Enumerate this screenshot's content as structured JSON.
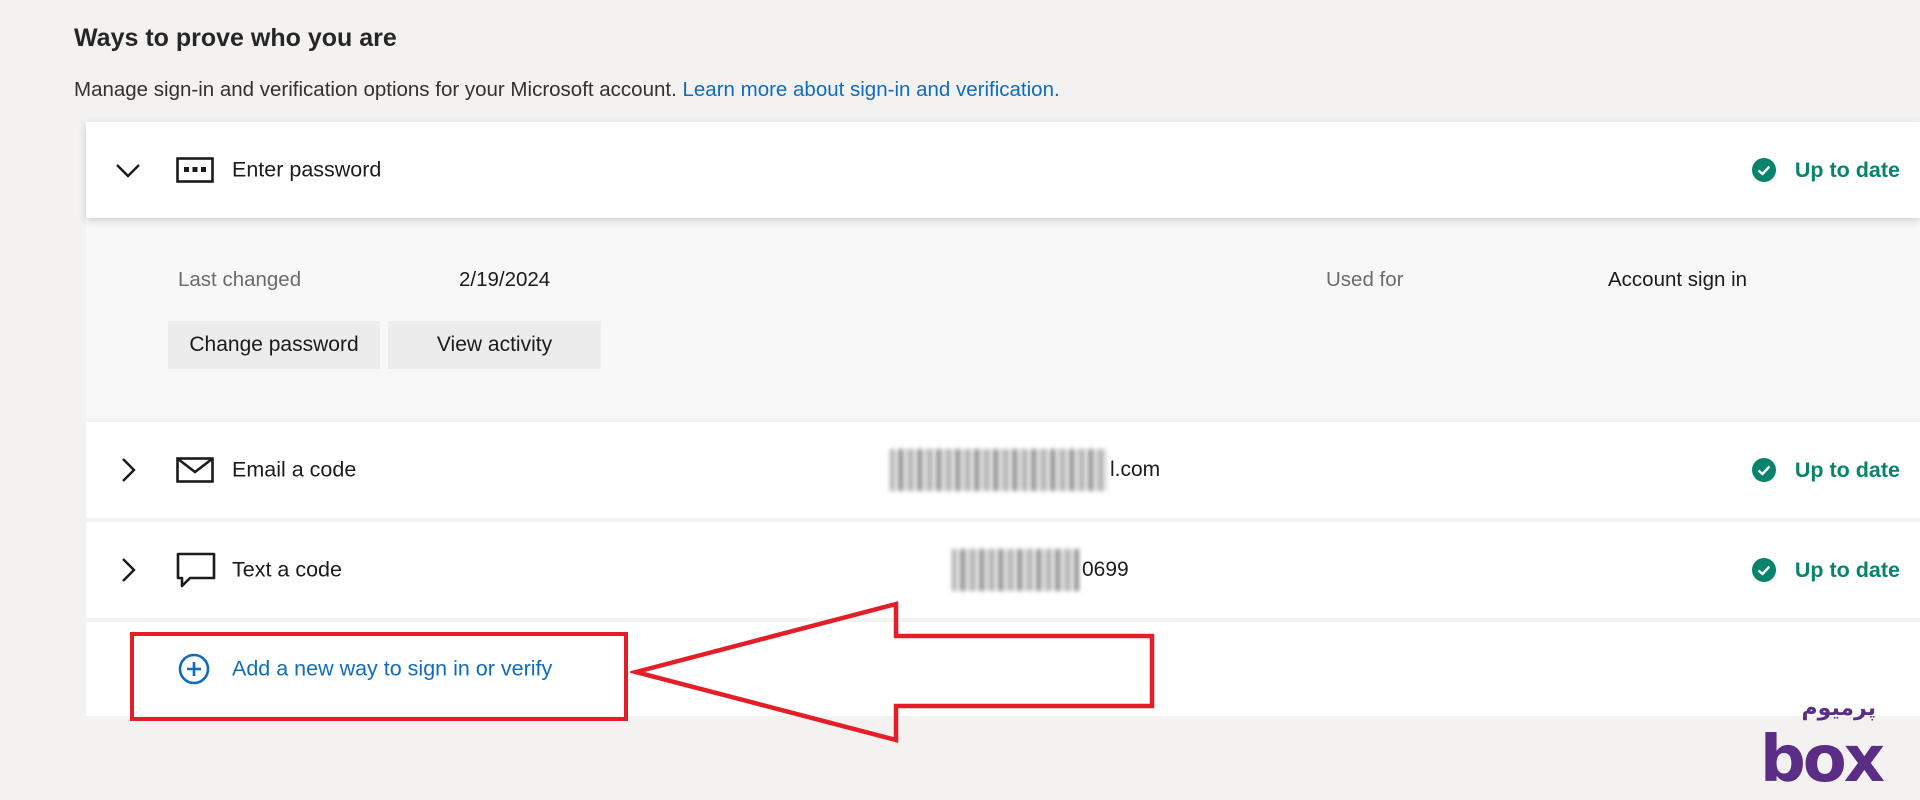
{
  "header": {
    "title": "Ways to prove who you are",
    "description": "Manage sign-in and verification options for your Microsoft account.",
    "learn_more_link": "Learn more about sign-in and verification."
  },
  "methods": [
    {
      "label": "Enter password",
      "icon": "password-icon",
      "expanded": true,
      "status": "Up to date",
      "details": {
        "last_changed_label": "Last changed",
        "last_changed_value": "2/19/2024",
        "used_for_label": "Used for",
        "used_for_value": "Account sign in"
      },
      "buttons": {
        "change_password": "Change password",
        "view_activity": "View activity"
      }
    },
    {
      "label": "Email a code",
      "icon": "mail-icon",
      "expanded": false,
      "detail_suffix": "l.com",
      "status": "Up to date"
    },
    {
      "label": "Text a code",
      "icon": "chat-icon",
      "expanded": false,
      "detail_suffix": "0699",
      "status": "Up to date"
    }
  ],
  "add_method": {
    "label": "Add a new way to sign in or verify"
  },
  "watermark": {
    "persian_text": "پرمیوم",
    "brand_text": "box"
  },
  "colors": {
    "accent_link": "#0f6cbd",
    "status_green": "#07846b",
    "annotation_red": "#e41e26",
    "watermark_purple": "#5b2d86"
  }
}
